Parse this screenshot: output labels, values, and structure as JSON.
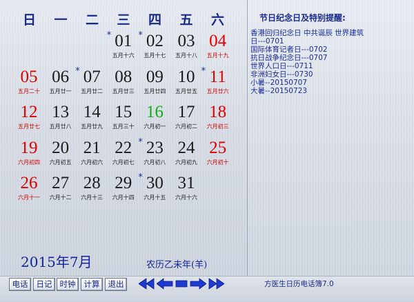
{
  "weekdays": [
    "日",
    "一",
    "二",
    "三",
    "四",
    "五",
    "六"
  ],
  "days": [
    {
      "day": "01",
      "lunar": "五月十六",
      "col": 3,
      "row": 0,
      "star": true,
      "color": "black"
    },
    {
      "day": "02",
      "lunar": "五月十七",
      "col": 4,
      "row": 0,
      "star": true,
      "color": "black"
    },
    {
      "day": "03",
      "lunar": "五月十八",
      "col": 5,
      "row": 0,
      "star": false,
      "color": "black"
    },
    {
      "day": "04",
      "lunar": "五月十九",
      "col": 6,
      "row": 0,
      "star": false,
      "color": "red"
    },
    {
      "day": "05",
      "lunar": "五月二十",
      "col": 0,
      "row": 1,
      "star": false,
      "color": "red"
    },
    {
      "day": "06",
      "lunar": "五月廿一",
      "col": 1,
      "row": 1,
      "star": false,
      "color": "black"
    },
    {
      "day": "07",
      "lunar": "五月廿二",
      "col": 2,
      "row": 1,
      "star": true,
      "color": "black"
    },
    {
      "day": "08",
      "lunar": "五月廿三",
      "col": 3,
      "row": 1,
      "star": false,
      "color": "black"
    },
    {
      "day": "09",
      "lunar": "五月廿四",
      "col": 4,
      "row": 1,
      "star": false,
      "color": "black"
    },
    {
      "day": "10",
      "lunar": "五月廿五",
      "col": 5,
      "row": 1,
      "star": false,
      "color": "black"
    },
    {
      "day": "11",
      "lunar": "五月廿六",
      "col": 6,
      "row": 1,
      "star": true,
      "color": "red"
    },
    {
      "day": "12",
      "lunar": "五月廿七",
      "col": 0,
      "row": 2,
      "star": false,
      "color": "red"
    },
    {
      "day": "13",
      "lunar": "五月廿八",
      "col": 1,
      "row": 2,
      "star": false,
      "color": "black"
    },
    {
      "day": "14",
      "lunar": "五月廿九",
      "col": 2,
      "row": 2,
      "star": false,
      "color": "black"
    },
    {
      "day": "15",
      "lunar": "五月三十",
      "col": 3,
      "row": 2,
      "star": false,
      "color": "black"
    },
    {
      "day": "16",
      "lunar": "六月初一",
      "col": 4,
      "row": 2,
      "star": false,
      "color": "green"
    },
    {
      "day": "17",
      "lunar": "六月初二",
      "col": 5,
      "row": 2,
      "star": false,
      "color": "black"
    },
    {
      "day": "18",
      "lunar": "六月初三",
      "col": 6,
      "row": 2,
      "star": false,
      "color": "red"
    },
    {
      "day": "19",
      "lunar": "六月初四",
      "col": 0,
      "row": 3,
      "star": false,
      "color": "red"
    },
    {
      "day": "20",
      "lunar": "六月初五",
      "col": 1,
      "row": 3,
      "star": false,
      "color": "black"
    },
    {
      "day": "21",
      "lunar": "六月初六",
      "col": 2,
      "row": 3,
      "star": false,
      "color": "black"
    },
    {
      "day": "22",
      "lunar": "六月初七",
      "col": 3,
      "row": 3,
      "star": false,
      "color": "black"
    },
    {
      "day": "23",
      "lunar": "六月初八",
      "col": 4,
      "row": 3,
      "star": true,
      "color": "black"
    },
    {
      "day": "24",
      "lunar": "六月初九",
      "col": 5,
      "row": 3,
      "star": false,
      "color": "black"
    },
    {
      "day": "25",
      "lunar": "六月初十",
      "col": 6,
      "row": 3,
      "star": false,
      "color": "red"
    },
    {
      "day": "26",
      "lunar": "六月十一",
      "col": 0,
      "row": 4,
      "star": false,
      "color": "red"
    },
    {
      "day": "27",
      "lunar": "六月十二",
      "col": 1,
      "row": 4,
      "star": false,
      "color": "black"
    },
    {
      "day": "28",
      "lunar": "六月十三",
      "col": 2,
      "row": 4,
      "star": false,
      "color": "black"
    },
    {
      "day": "29",
      "lunar": "六月十四",
      "col": 3,
      "row": 4,
      "star": false,
      "color": "black"
    },
    {
      "day": "30",
      "lunar": "六月十五",
      "col": 4,
      "row": 4,
      "star": true,
      "color": "black"
    },
    {
      "day": "31",
      "lunar": "六月十六",
      "col": 5,
      "row": 4,
      "star": false,
      "color": "black"
    }
  ],
  "month_title": "2015年7月",
  "lunar_year": "农历乙未年(羊)",
  "notes": {
    "title": "节日纪念日及特别提醒:",
    "lines": [
      "香港回归纪念日 中共诞辰 世界建筑",
      "日---0701",
      "国际体育记者日---0702",
      "抗日战争纪念日---0707",
      "世界人口日---0711",
      "非洲妇女日---0730",
      "小暑--20150707",
      "大暑--20150723"
    ]
  },
  "toolbar": {
    "buttons": [
      "电话",
      "日记",
      "时钟",
      "计算",
      "退出"
    ],
    "nav_icons": [
      "double-left-arrow-icon",
      "left-arrow-icon",
      "today-square-icon",
      "right-arrow-icon",
      "double-right-arrow-icon"
    ]
  },
  "app_title": "方医生日历电话簿7.0",
  "colors": {
    "accent": "#1a2a8c",
    "holiday_red": "#e00000",
    "new_moon_green": "#18a818",
    "nav_blue": "#1f3ad0"
  }
}
